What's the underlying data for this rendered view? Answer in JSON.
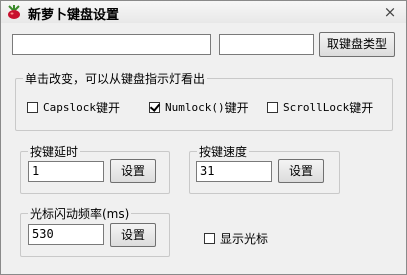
{
  "window": {
    "title": "新萝卜键盘设置",
    "close_glyph": "×"
  },
  "top": {
    "field1_value": "",
    "field2_value": "",
    "get_type_button": "取键盘类型"
  },
  "indicator_group": {
    "title": "单击改变，可以从键盘指示灯看出",
    "options": [
      {
        "prefix": "Capslock",
        "suffix": "键开",
        "checked": false
      },
      {
        "prefix": "Numlock()",
        "suffix": "键开",
        "checked": true
      },
      {
        "prefix": "ScrollLock",
        "suffix": "键开",
        "checked": false
      }
    ]
  },
  "key_delay": {
    "title": "按键延时",
    "value": "1",
    "button": "设置"
  },
  "key_speed": {
    "title": "按键速度",
    "value": "31",
    "button": "设置"
  },
  "cursor_blink": {
    "title": "光标闪动频率(ms)",
    "value": "530",
    "button": "设置"
  },
  "show_cursor": {
    "label": "显示光标",
    "checked": false
  }
}
